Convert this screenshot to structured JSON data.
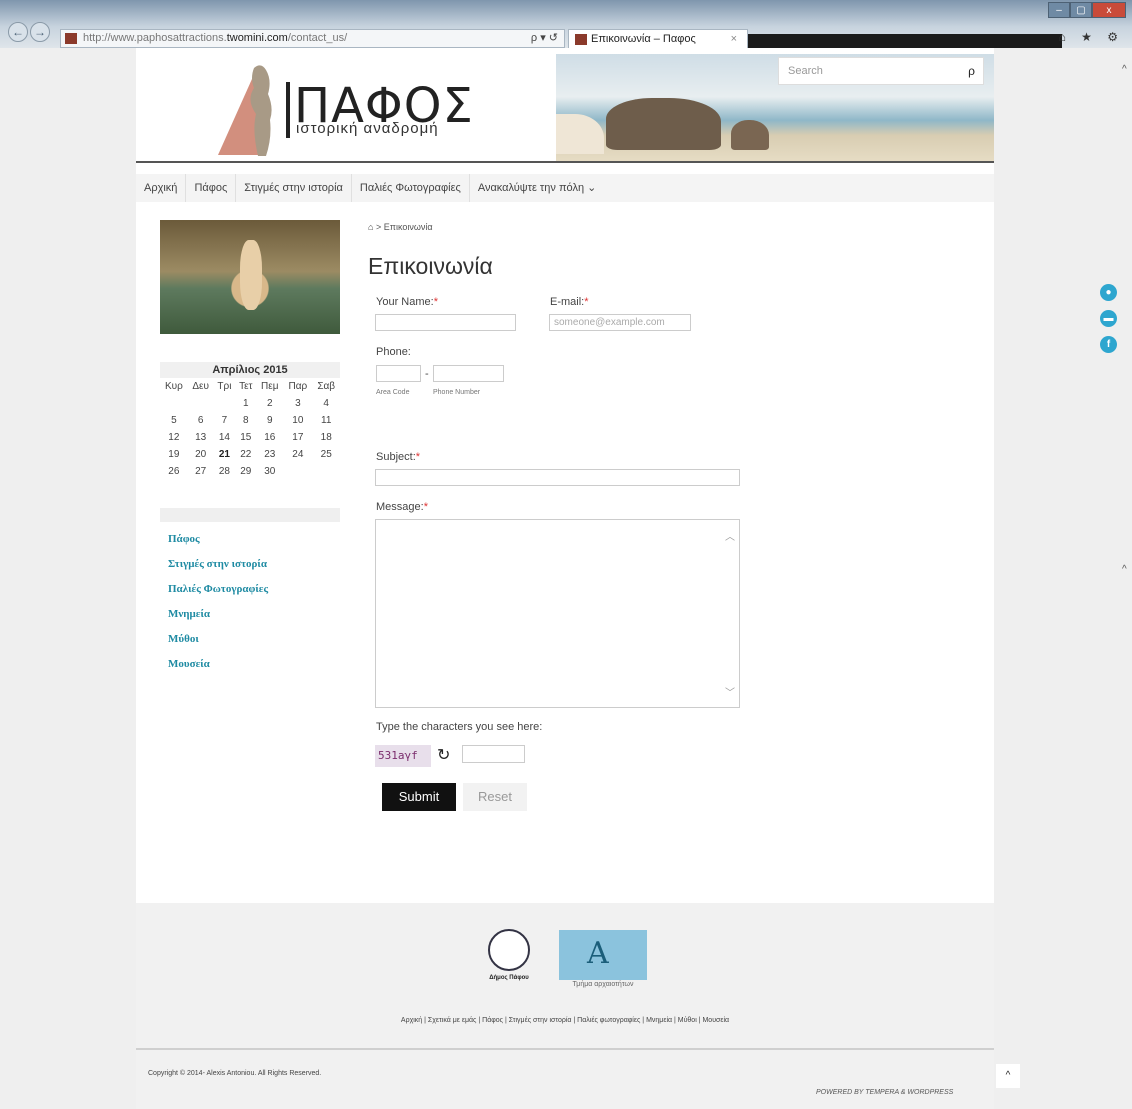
{
  "browser": {
    "url_prefix": "http://www.paphosattractions.",
    "url_domain": "twomini.com",
    "url_path": "/contact_us/",
    "url_tools": "ρ ▾ ↺",
    "tab_title": "Επικοινωνία – Παφος",
    "tab_close": "×",
    "back": "←",
    "forward": "→",
    "minimize": "–",
    "maximize": "▢",
    "close": "x",
    "right_icons": "⌂ ★ ⚙"
  },
  "header": {
    "logo_title": "ΠΑΦΟΣ",
    "logo_subtitle": "ιστορική αναδρομή",
    "search_placeholder": "Search",
    "search_icon": "ρ"
  },
  "nav": {
    "items": [
      "Αρχική",
      "Πάφος",
      "Στιγμές στην ιστορία",
      "Παλιές Φωτογραφίες",
      "Ανακαλύψτε την πόλη ⌄"
    ]
  },
  "calendar": {
    "title": "Απρίλιος 2015",
    "weekdays": [
      "Κυρ",
      "Δευ",
      "Τρι",
      "Τετ",
      "Πεμ",
      "Παρ",
      "Σαβ"
    ],
    "weeks": [
      [
        "",
        "",
        "",
        "1",
        "2",
        "3",
        "4"
      ],
      [
        "5",
        "6",
        "7",
        "8",
        "9",
        "10",
        "11"
      ],
      [
        "12",
        "13",
        "14",
        "15",
        "16",
        "17",
        "18"
      ],
      [
        "19",
        "20",
        "21",
        "22",
        "23",
        "24",
        "25"
      ],
      [
        "26",
        "27",
        "28",
        "29",
        "30",
        "",
        ""
      ]
    ],
    "today": "21"
  },
  "sidebar": {
    "links": [
      "Πάφος",
      "Στιγμές στην ιστορία",
      "Παλιές Φωτογραφίες",
      "Μνημεία",
      "Μύθοι",
      "Μουσεία"
    ]
  },
  "breadcrumb": {
    "home_icon": "⌂",
    "sep": ">",
    "current": "Επικοινωνία"
  },
  "form": {
    "title": "Επικοινωνία",
    "name_label": "Your Name:",
    "email_label": "E-mail:",
    "email_placeholder": "someone@example.com",
    "phone_label": "Phone:",
    "phone_dash": "-",
    "area_code_caption": "Area Code",
    "phone_number_caption": "Phone Number",
    "subject_label": "Subject:",
    "message_label": "Message:",
    "required_mark": "*",
    "captcha_label": "Type the characters you see here:",
    "captcha_text": "531aγf",
    "submit_label": "Submit",
    "reset_label": "Reset"
  },
  "footer": {
    "logo1_caption": "Δήμος Πάφου",
    "logo2_caption": "Τμήμα αρχαιοτήτων",
    "links": "Αρχική | Σχετικά με εμάς | Πάφος | Στιγμές στην ιστορία | Παλιές φωτογραφίες | Μνημεία | Μύθοι | Μουσεία",
    "copyright": "Copyright © 2014- Alexis Antoniou. All Rights Reserved.",
    "powered": "POWERED BY TEMPERA & WORDPRESS",
    "to_top": "^"
  },
  "social": [
    "person-icon",
    "chat-icon",
    "facebook-icon"
  ]
}
